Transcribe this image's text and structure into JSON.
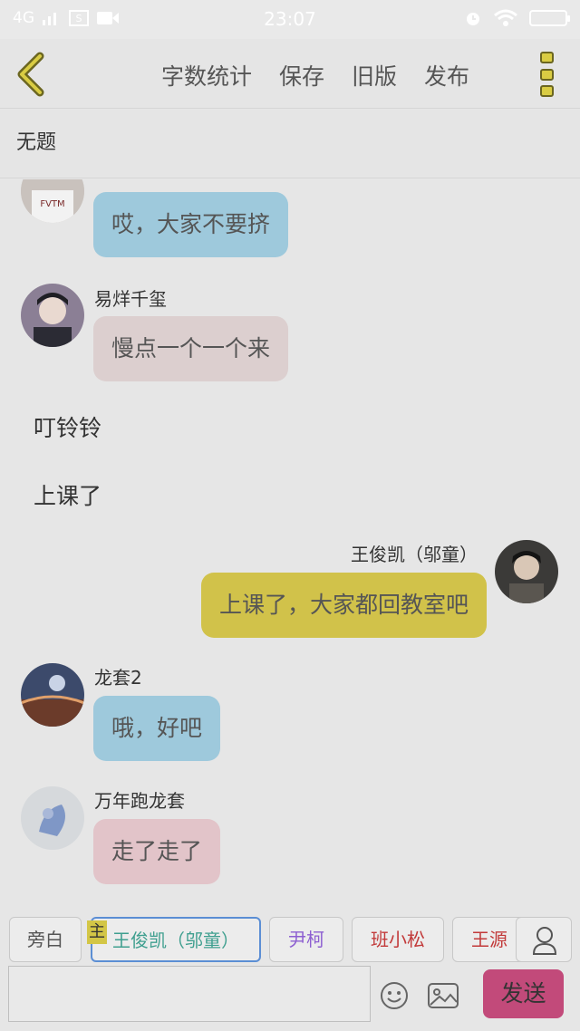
{
  "status_bar": {
    "network": "4G",
    "time": "23:07"
  },
  "toolbar": {
    "actions": [
      "字数统计",
      "保存",
      "旧版",
      "发布"
    ]
  },
  "document": {
    "title": "无题"
  },
  "messages": [
    {
      "type": "left",
      "name": "",
      "text": "哎，大家不要挤",
      "bubble_color": "#9ec9dc"
    },
    {
      "type": "left",
      "name": "易烊千玺",
      "text": "慢点一个一个来",
      "bubble_color": "#dccfcf"
    },
    {
      "type": "narration",
      "text": "叮铃铃"
    },
    {
      "type": "narration",
      "text": "上课了"
    },
    {
      "type": "right",
      "name": "王俊凯（邬童）",
      "text": "上课了，大家都回教室吧",
      "bubble_color": "#d1c24a"
    },
    {
      "type": "left",
      "name": "龙套2",
      "text": "哦，好吧",
      "bubble_color": "#9ec9dc"
    },
    {
      "type": "left",
      "name": "万年跑龙套",
      "text": "走了走了",
      "bubble_color": "#e2c4c9"
    }
  ],
  "roles": [
    {
      "label": "旁白",
      "color": "#555555"
    },
    {
      "label": "王俊凯（邬童）",
      "color": "#3f9f8f",
      "selected": true,
      "tag": "主"
    },
    {
      "label": "尹柯",
      "color": "#8d5fd1"
    },
    {
      "label": "班小松",
      "color": "#c23a3a"
    },
    {
      "label": "王源",
      "color": "#c23a3a"
    }
  ],
  "composer": {
    "input_value": "",
    "send_label": "发送"
  }
}
